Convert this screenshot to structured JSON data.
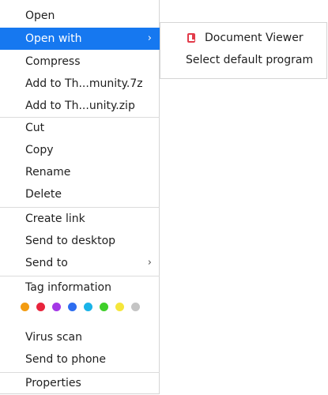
{
  "menu": {
    "open": "Open",
    "open_with": "Open with",
    "compress": "Compress",
    "add_7z": "Add to Th...munity.7z",
    "add_zip": "Add to Th...unity.zip",
    "cut": "Cut",
    "copy": "Copy",
    "rename": "Rename",
    "delete": "Delete",
    "create_link": "Create link",
    "send_to_desktop": "Send to desktop",
    "send_to": "Send to",
    "tag_information": "Tag information",
    "virus_scan": "Virus scan",
    "send_to_phone": "Send to phone",
    "properties": "Properties",
    "submenu_arrow": "›"
  },
  "tags": [
    "#f39c12",
    "#e8243c",
    "#a438e6",
    "#2d6df0",
    "#1ab3e8",
    "#3fcf2a",
    "#f5e63b",
    "#c4c4c4"
  ],
  "submenu": {
    "document_viewer": "Document Viewer",
    "select_default": "Select default program",
    "document_viewer_icon": "document-viewer-icon"
  },
  "colors": {
    "accent": "#1678f0",
    "doc_icon": "#e23b4a"
  }
}
